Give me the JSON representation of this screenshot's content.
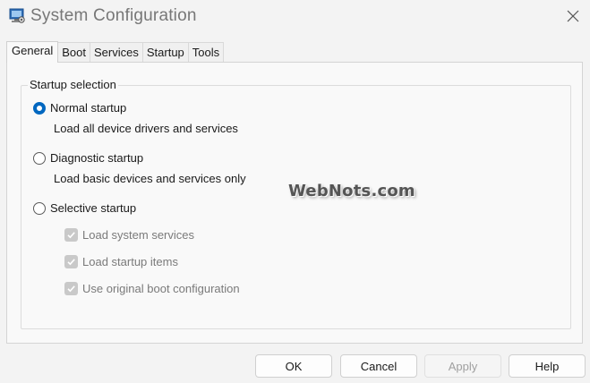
{
  "window": {
    "title": "System Configuration"
  },
  "tabs": [
    "General",
    "Boot",
    "Services",
    "Startup",
    "Tools"
  ],
  "active_tab": "General",
  "general": {
    "group_label": "Startup selection",
    "options": [
      {
        "label": "Normal startup",
        "description": "Load all device drivers and services",
        "checked": true
      },
      {
        "label": "Diagnostic startup",
        "description": "Load basic devices and services only",
        "checked": false
      },
      {
        "label": "Selective startup",
        "checked": false
      }
    ],
    "selective_items": [
      {
        "label": "Load system services",
        "checked": true,
        "disabled": true
      },
      {
        "label": "Load startup items",
        "checked": true,
        "disabled": true
      },
      {
        "label": "Use original boot configuration",
        "checked": true,
        "disabled": true
      }
    ]
  },
  "buttons": {
    "ok": "OK",
    "cancel": "Cancel",
    "apply": "Apply",
    "help": "Help"
  },
  "watermark": "WebNots.com",
  "colors": {
    "accent": "#0067c0",
    "background": "#f3f3f3",
    "panel": "#f9f9f9",
    "disabled_check": "#c9c9c9"
  },
  "icons": {
    "app": "system-configuration-icon",
    "close": "close-icon",
    "check": "checkmark-icon"
  }
}
